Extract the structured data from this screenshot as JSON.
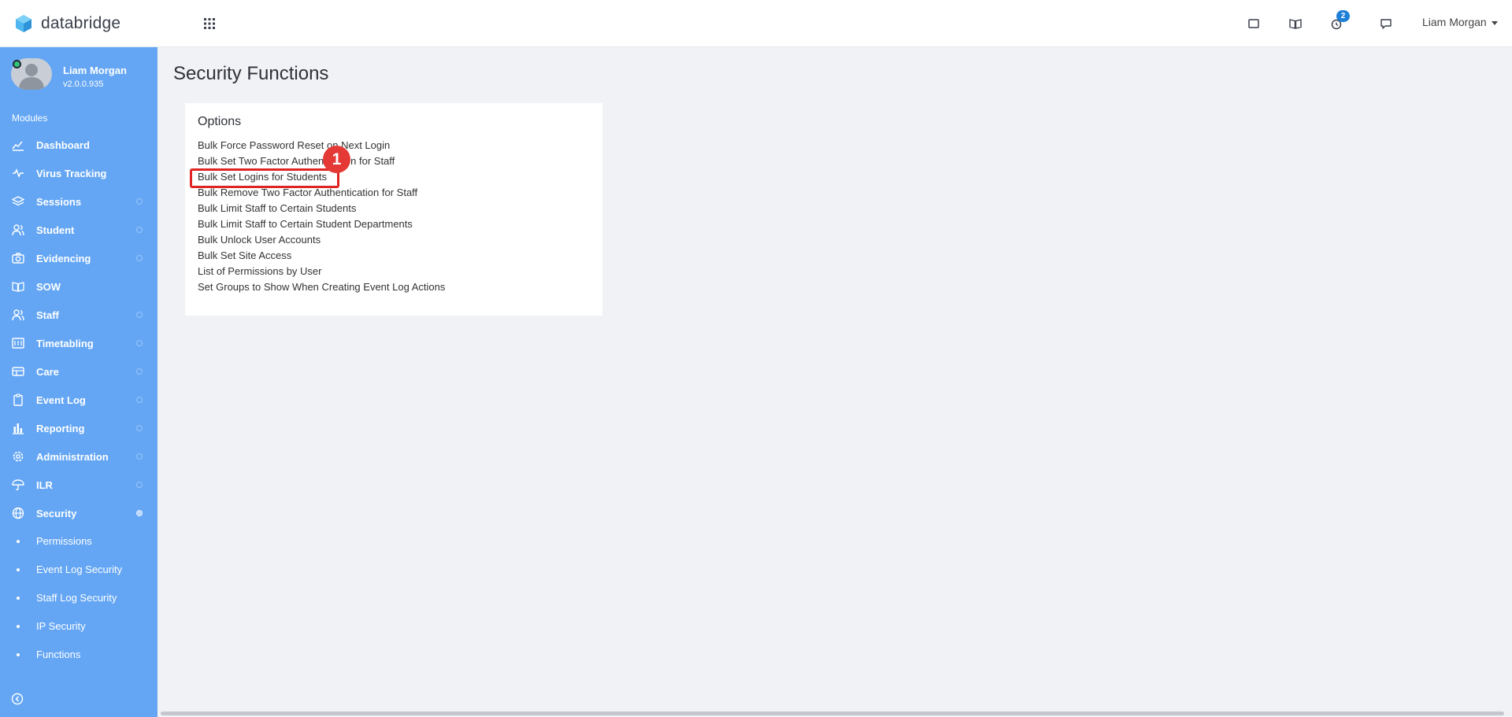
{
  "header": {
    "brand": "databridge",
    "notification_count": "2",
    "user_name": "Liam Morgan",
    "icons": [
      "grid-icon",
      "window-icon",
      "book-icon",
      "timer-icon",
      "chat-icon"
    ]
  },
  "sidebar": {
    "profile": {
      "name": "Liam Morgan",
      "version": "v2.0.0.935"
    },
    "modules_label": "Modules",
    "items": [
      {
        "label": "Dashboard",
        "icon": "chart-line-icon"
      },
      {
        "label": "Virus Tracking",
        "icon": "pulse-icon"
      },
      {
        "label": "Sessions",
        "icon": "layers-icon"
      },
      {
        "label": "Student",
        "icon": "users-icon"
      },
      {
        "label": "Evidencing",
        "icon": "camera-icon"
      },
      {
        "label": "SOW",
        "icon": "book-open-icon"
      },
      {
        "label": "Staff",
        "icon": "users-icon"
      },
      {
        "label": "Timetabling",
        "icon": "calendar-icon"
      },
      {
        "label": "Care",
        "icon": "card-icon"
      },
      {
        "label": "Event Log",
        "icon": "clipboard-icon"
      },
      {
        "label": "Reporting",
        "icon": "bar-chart-icon"
      },
      {
        "label": "Administration",
        "icon": "gear-icon"
      },
      {
        "label": "ILR",
        "icon": "umbrella-icon"
      },
      {
        "label": "Security",
        "icon": "globe-icon"
      }
    ],
    "security_sub_items": [
      {
        "label": "Permissions"
      },
      {
        "label": "Event Log Security"
      },
      {
        "label": "Staff Log Security"
      },
      {
        "label": "IP Security"
      },
      {
        "label": "Functions"
      }
    ]
  },
  "main": {
    "title": "Security Functions",
    "card_title": "Options",
    "options": [
      "Bulk Force Password Reset on Next Login",
      "Bulk Set Two Factor Authentication for Staff",
      "Bulk Set Logins for Students",
      "Bulk Remove Two Factor Authentication for Staff",
      "Bulk Limit Staff to Certain Students",
      "Bulk Limit Staff to Certain Student Departments",
      "Bulk Unlock User Accounts",
      "Bulk Set Site Access",
      "List of Permissions by User",
      "Set Groups to Show When Creating Event Log Actions"
    ]
  },
  "annotation": {
    "step": "1"
  },
  "colors": {
    "sidebar": "#64a6f4",
    "highlight": "#e02424",
    "badge": "#1e7fd6"
  }
}
